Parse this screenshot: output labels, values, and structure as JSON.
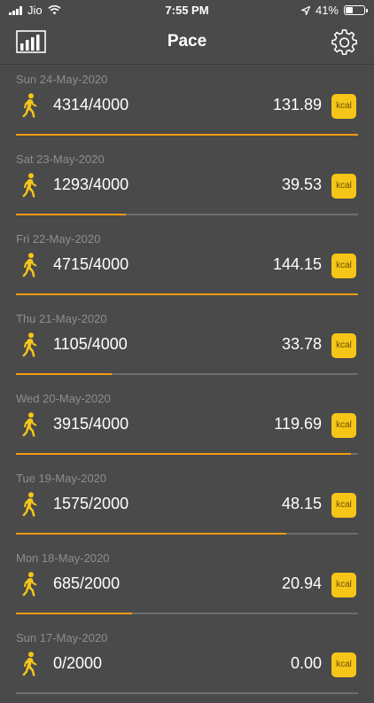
{
  "status_bar": {
    "carrier": "Jio",
    "time": "7:55 PM",
    "battery": "41%",
    "battery_level": 0.41
  },
  "header": {
    "title": "Pace",
    "left_icon": "bar-chart-icon",
    "right_icon": "gear-icon"
  },
  "colors": {
    "background": "#4a4a4a",
    "accent": "#f5c518",
    "progress": "#f59b12",
    "track": "#6e6e6e"
  },
  "kcal_label": "kcal",
  "days": [
    {
      "date": "Sun 24-May-2020",
      "steps": "4314/4000",
      "kcal": "131.89",
      "progress": 1.0
    },
    {
      "date": "Sat 23-May-2020",
      "steps": "1293/4000",
      "kcal": "39.53",
      "progress": 0.32
    },
    {
      "date": "Fri 22-May-2020",
      "steps": "4715/4000",
      "kcal": "144.15",
      "progress": 1.0
    },
    {
      "date": "Thu 21-May-2020",
      "steps": "1105/4000",
      "kcal": "33.78",
      "progress": 0.28
    },
    {
      "date": "Wed 20-May-2020",
      "steps": "3915/4000",
      "kcal": "119.69",
      "progress": 0.98
    },
    {
      "date": "Tue 19-May-2020",
      "steps": "1575/2000",
      "kcal": "48.15",
      "progress": 0.79
    },
    {
      "date": "Mon 18-May-2020",
      "steps": "685/2000",
      "kcal": "20.94",
      "progress": 0.34
    },
    {
      "date": "Sun 17-May-2020",
      "steps": "0/2000",
      "kcal": "0.00",
      "progress": 0.0
    }
  ]
}
